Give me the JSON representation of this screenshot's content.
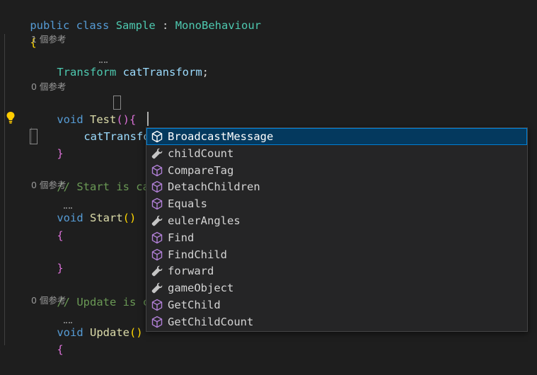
{
  "code": {
    "class_decl": {
      "kw1": "public",
      "kw2": "class",
      "name": "Sample",
      "colon": " : ",
      "base": "MonoBehaviour"
    },
    "open_brace": "{",
    "refs1": "1 個参考",
    "field": {
      "type": "Transform",
      "name": "catTransform",
      "semi": ";"
    },
    "refs2": "0 個参考",
    "test_sig": {
      "kw": "void",
      "name": "Test",
      "parens": "()",
      "brace": "{"
    },
    "current_line": "catTransform.",
    "test_close": "}",
    "comment1": "// Start is calle",
    "refs3": "0 個参考",
    "start_sig": {
      "kw": "void",
      "name": "Start",
      "parens": "()"
    },
    "start_open": "{",
    "start_close": "}",
    "comment2": "// Update is call",
    "refs4": "0 個参考",
    "update_sig": {
      "kw": "void",
      "name": "Update",
      "parens": "()"
    },
    "update_open": "{"
  },
  "suggestions": [
    {
      "label": "BroadcastMessage",
      "kind": "method",
      "selected": true
    },
    {
      "label": "childCount",
      "kind": "property"
    },
    {
      "label": "CompareTag",
      "kind": "method"
    },
    {
      "label": "DetachChildren",
      "kind": "method"
    },
    {
      "label": "Equals",
      "kind": "method"
    },
    {
      "label": "eulerAngles",
      "kind": "property"
    },
    {
      "label": "Find",
      "kind": "method"
    },
    {
      "label": "FindChild",
      "kind": "method"
    },
    {
      "label": "forward",
      "kind": "property"
    },
    {
      "label": "gameObject",
      "kind": "property"
    },
    {
      "label": "GetChild",
      "kind": "method"
    },
    {
      "label": "GetChildCount",
      "kind": "method"
    }
  ],
  "colors": {
    "method_icon": "#b180d7",
    "property_icon": "#c5c5c5",
    "selection": "#04395e"
  }
}
